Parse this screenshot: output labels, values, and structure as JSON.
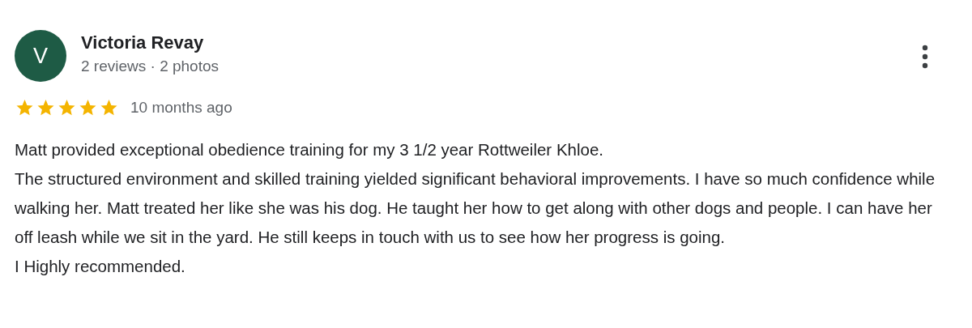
{
  "reviewer": {
    "initial": "V",
    "name": "Victoria Revay",
    "meta": "2 reviews · 2 photos"
  },
  "review": {
    "stars": 5,
    "time": "10 months ago",
    "paragraphs": [
      "Matt provided exceptional obedience training for my 3 1/2 year Rottweiler Khloe.",
      "The structured environment and skilled training yielded significant behavioral improvements. I have so much confidence while walking her. Matt treated her like she was his dog. He taught her how to get along with other dogs and people. I can have her off leash while we sit in the yard. He still keeps in touch with us to see how her progress is going.",
      "I Highly recommended."
    ]
  }
}
